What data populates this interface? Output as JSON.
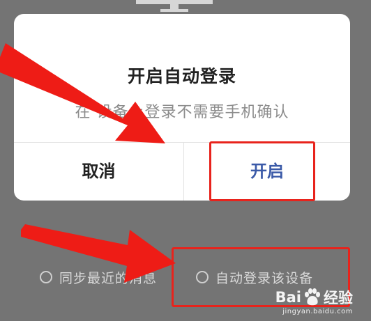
{
  "dialog": {
    "title": "开启自动登录",
    "message": "在    设备上登录不需要手机确认",
    "cancel_label": "取消",
    "enable_label": "开启"
  },
  "options": {
    "sync_label": "同步最近的消息",
    "auto_login_label": "自动登录该设备"
  },
  "watermark": {
    "brand_left": "Bai",
    "brand_right": "经验",
    "url": "jingyan.baidu.com"
  },
  "colors": {
    "overlay": "#747474",
    "dialog_bg": "#ffffff",
    "enable_blue": "#3b5aa8",
    "highlight_red": "#e8231c"
  },
  "icons": [
    "monitor-icon",
    "red-arrow",
    "radio-icon",
    "baidu-paw-icon"
  ]
}
